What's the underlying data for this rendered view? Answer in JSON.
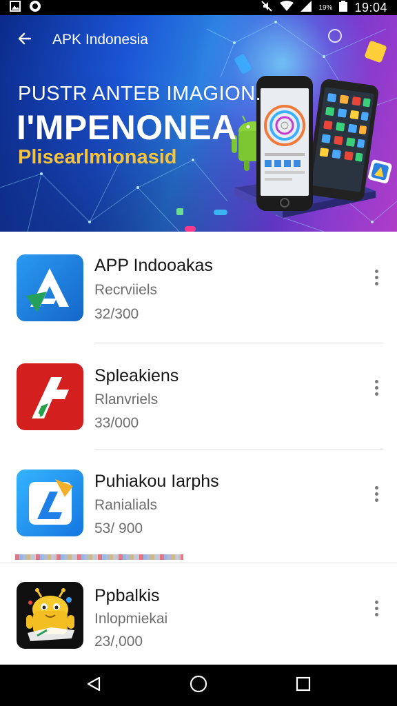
{
  "status_bar": {
    "time": "19:04",
    "battery_text": "19%",
    "icons": [
      "gallery-icon",
      "notification-icon",
      "mute-icon",
      "wifi-icon",
      "signal-icon",
      "battery-icon"
    ]
  },
  "header": {
    "back_icon": "arrow-left-icon",
    "title": "APK Indonesia"
  },
  "banner": {
    "line1": "PUSTR ANTEB IMAGION.",
    "line2": "I'MPENONEA",
    "line3": "Plisearlmionasid",
    "accent_color": "#f7c33b"
  },
  "apps": [
    {
      "name": "APP Indooakas",
      "subtitle": "Recrviiels",
      "count": "32/300",
      "icon": "app-a-icon",
      "icon_color": "#1e7fe0"
    },
    {
      "name": "Spleakiens",
      "subtitle": "Rlanvriels",
      "count": "33/000",
      "icon": "app-red-icon",
      "icon_color": "#d62020"
    },
    {
      "name": "Puhiakou Iarphs",
      "subtitle": "Ranialials",
      "count": "53/ 900",
      "icon": "app-blue-icon",
      "icon_color": "#1d8ff2"
    },
    {
      "name": "Ppbalkis",
      "subtitle": "Inlopmiekai",
      "count": "23/,000",
      "icon": "android-mascot-icon",
      "icon_color": "#111111"
    }
  ],
  "nav": {
    "back": "nav-back-icon",
    "home": "nav-home-icon",
    "recents": "nav-recents-icon"
  }
}
